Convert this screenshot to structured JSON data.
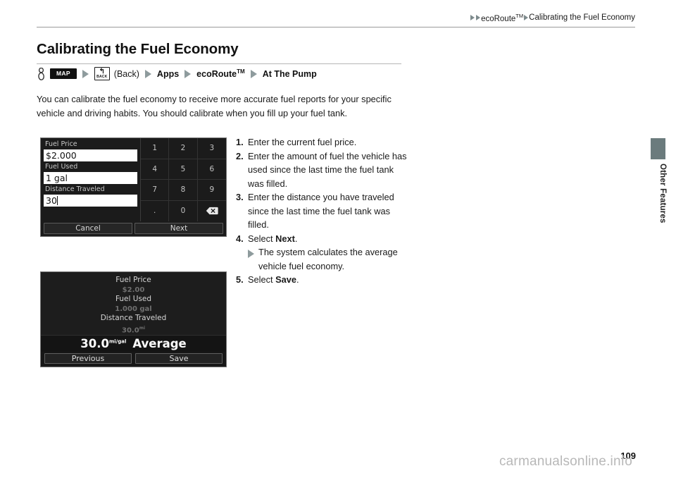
{
  "header": {
    "breadcrumb": [
      {
        "type": "arrow",
        "icon": "triangle-right-icon"
      },
      {
        "type": "arrow",
        "icon": "triangle-right-icon"
      },
      {
        "type": "text",
        "label": "ecoRoute",
        "tm": "TM"
      },
      {
        "type": "arrow",
        "icon": "triangle-right-icon"
      },
      {
        "type": "text",
        "label": "Calibrating the Fuel Economy",
        "tm": ""
      }
    ]
  },
  "page": {
    "title": "Calibrating the Fuel Economy",
    "number": "109",
    "watermark": "carmanualsonline.info"
  },
  "navpath": {
    "hand_icon": "hand-pointer-icon",
    "map_button": "MAP",
    "back_button": {
      "arrow": "↰",
      "label": "BACK",
      "caption": "(Back)"
    },
    "items": [
      "Apps",
      "ecoRoute",
      "At The Pump"
    ],
    "tm": "TM"
  },
  "body": {
    "paragraph": "You can calibrate the fuel economy to receive more accurate fuel reports for your specific vehicle and driving habits. You should calibrate when you fill up your fuel tank."
  },
  "steps": [
    {
      "num": "1.",
      "text": "Enter the current fuel price."
    },
    {
      "num": "2.",
      "text": "Enter the amount of fuel the vehicle has used since the last time the fuel tank was filled."
    },
    {
      "num": "3.",
      "text": "Enter the distance you have traveled since the last time the fuel tank was filled."
    },
    {
      "num": "4.",
      "text_before": "Select ",
      "bold": "Next",
      "text_after": ".",
      "substep": "The system calculates the average vehicle fuel economy."
    },
    {
      "num": "5.",
      "text_before": "Select ",
      "bold": "Save",
      "text_after": "."
    }
  ],
  "device_entry": {
    "fields": [
      {
        "label": "Fuel Price",
        "value": "$2.000",
        "caret": false
      },
      {
        "label": "Fuel Used",
        "value": "1 gal",
        "caret": false
      },
      {
        "label": "Distance Traveled",
        "value": "30",
        "caret": true
      }
    ],
    "keypad": [
      "1",
      "2",
      "3",
      "4",
      "5",
      "6",
      "7",
      "8",
      "9",
      ".",
      "0",
      "backspace-icon"
    ],
    "buttons": {
      "cancel": "Cancel",
      "next": "Next"
    }
  },
  "device_result": {
    "rows": [
      {
        "label": "Fuel Price",
        "value": "$2.00",
        "unit": ""
      },
      {
        "label": "Fuel Used",
        "value": "1.000 gal",
        "unit": ""
      },
      {
        "label": "Distance Traveled",
        "value": "30.0",
        "unit": "mi"
      }
    ],
    "average": {
      "value": "30.0",
      "unit": "mi/gal",
      "label": "Average"
    },
    "buttons": {
      "previous": "Previous",
      "save": "Save"
    }
  },
  "side_tab": {
    "label": "Other Features",
    "color": "#6b7b7d"
  }
}
